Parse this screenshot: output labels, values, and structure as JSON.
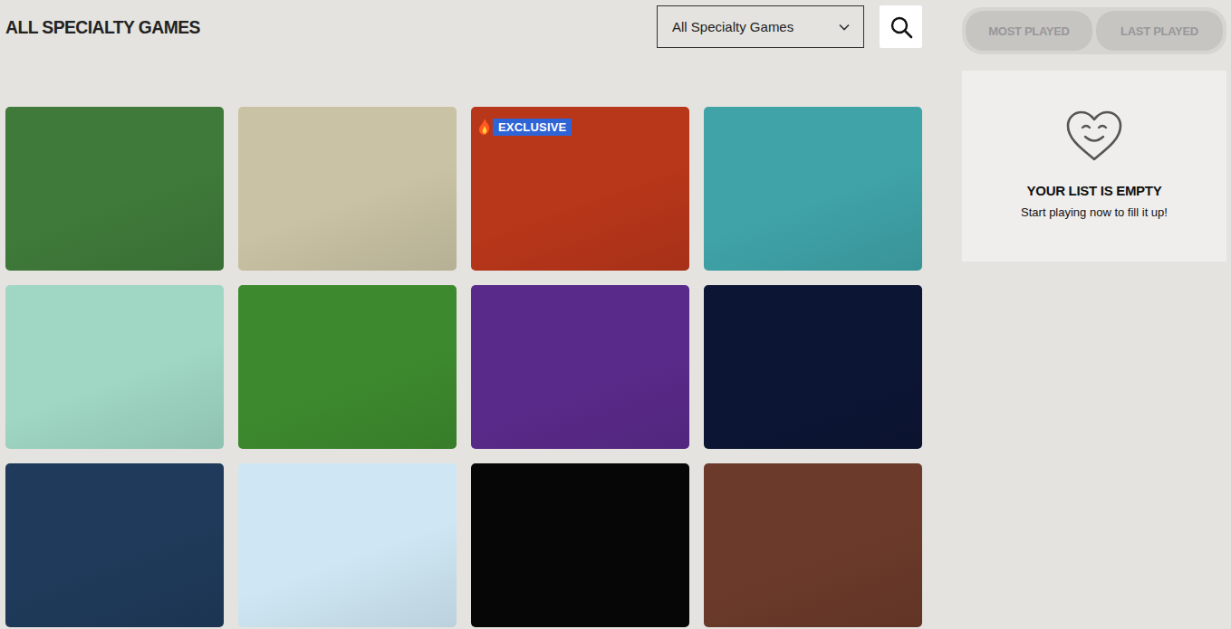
{
  "page": {
    "title": "ALL SPECIALTY GAMES"
  },
  "filter": {
    "value": "All Specialty Games"
  },
  "search": {
    "label": "search"
  },
  "sidebar": {
    "tabs": [
      {
        "label": "MOST PLAYED",
        "selected": false
      },
      {
        "label": "LAST PLAYED",
        "selected": false
      }
    ],
    "empty_state": {
      "title": "YOUR LIST IS EMPTY",
      "subtitle": "Start playing now to fill it up!"
    }
  },
  "games": [
    {
      "color": "#3f7a3a"
    },
    {
      "color": "#c9c2a4"
    },
    {
      "color": "#b8361a",
      "badge": "EXCLUSIVE"
    },
    {
      "color": "#3fa3a8"
    },
    {
      "color": "#9fd6c4"
    },
    {
      "color": "#3d8a2e"
    },
    {
      "color": "#5a2a8a"
    },
    {
      "color": "#0c1534"
    },
    {
      "color": "#1f3a5a"
    },
    {
      "color": "#cfe7f4"
    },
    {
      "color": "#060606"
    },
    {
      "color": "#6b3a2a"
    }
  ]
}
